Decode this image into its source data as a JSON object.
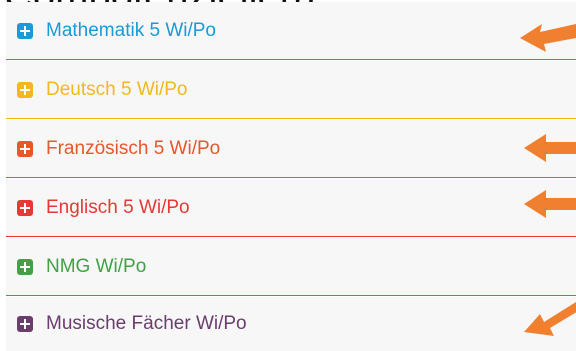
{
  "header_fragment": "Compotenziellen).",
  "rows": [
    {
      "label": "Mathematik 5 Wi/Po",
      "color": "#1a9ad6"
    },
    {
      "label": "Deutsch 5 Wi/Po",
      "color": "#f3b81c"
    },
    {
      "label": "Französisch 5 Wi/Po",
      "color": "#e8572c"
    },
    {
      "label": "Englisch 5 Wi/Po",
      "color": "#e53935"
    },
    {
      "label": "NMG Wi/Po",
      "color": "#43a047"
    },
    {
      "label": "Musische Fächer Wi/Po",
      "color": "#6a3d6d"
    }
  ],
  "icons": {
    "expand": "plus-square-icon",
    "pointer": "orange-arrow-icon"
  },
  "arrow_color": "#f0802f"
}
